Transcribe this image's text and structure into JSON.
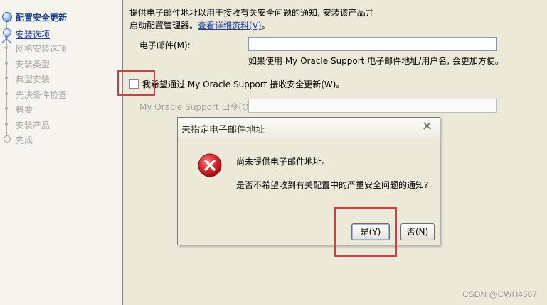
{
  "sidebar": {
    "steps": [
      {
        "label": "配置安全更新",
        "state": "current"
      },
      {
        "label": "安装选项",
        "state": "link"
      },
      {
        "label": "网格安装选项",
        "state": "disabled"
      },
      {
        "label": "安装类型",
        "state": "disabled"
      },
      {
        "label": "典型安装",
        "state": "disabled"
      },
      {
        "label": "先决条件检查",
        "state": "disabled"
      },
      {
        "label": "概要",
        "state": "disabled"
      },
      {
        "label": "安装产品",
        "state": "disabled"
      },
      {
        "label": "完成",
        "state": "disabled"
      }
    ]
  },
  "main": {
    "description_line1": "提供电子邮件地址以用于接收有关安全问题的通知, 安装该产品并",
    "description_line2_prefix": "启动配置管理器。",
    "details_link": "查看详细资料(V)",
    "description_line2_suffix": "。",
    "email_label": "电子邮件(M):",
    "email_value": "",
    "email_hint": "如果使用 My Oracle Support 电子邮件地址/用户名, 会更加方便。",
    "checkbox_label": "我希望通过 My Oracle Support 接收安全更新(W)。",
    "checkbox_checked": false,
    "password_label": "My Oracle Support 口令(O):",
    "password_value": ""
  },
  "dialog": {
    "title": "未指定电子邮件地址",
    "close_glyph": "✕",
    "icon": "error-icon",
    "message1": "尚未提供电子邮件地址。",
    "message2": "是否不希望收到有关配置中的严重安全问题的通知?",
    "yes_label": "是(Y)",
    "no_label": "否(N)"
  },
  "watermark": "CSDN @CWH4567",
  "colors": {
    "background": "#ece9d8",
    "link": "#1a3fb0",
    "highlight_box": "#e0383a",
    "error_red": "#d9262c"
  }
}
